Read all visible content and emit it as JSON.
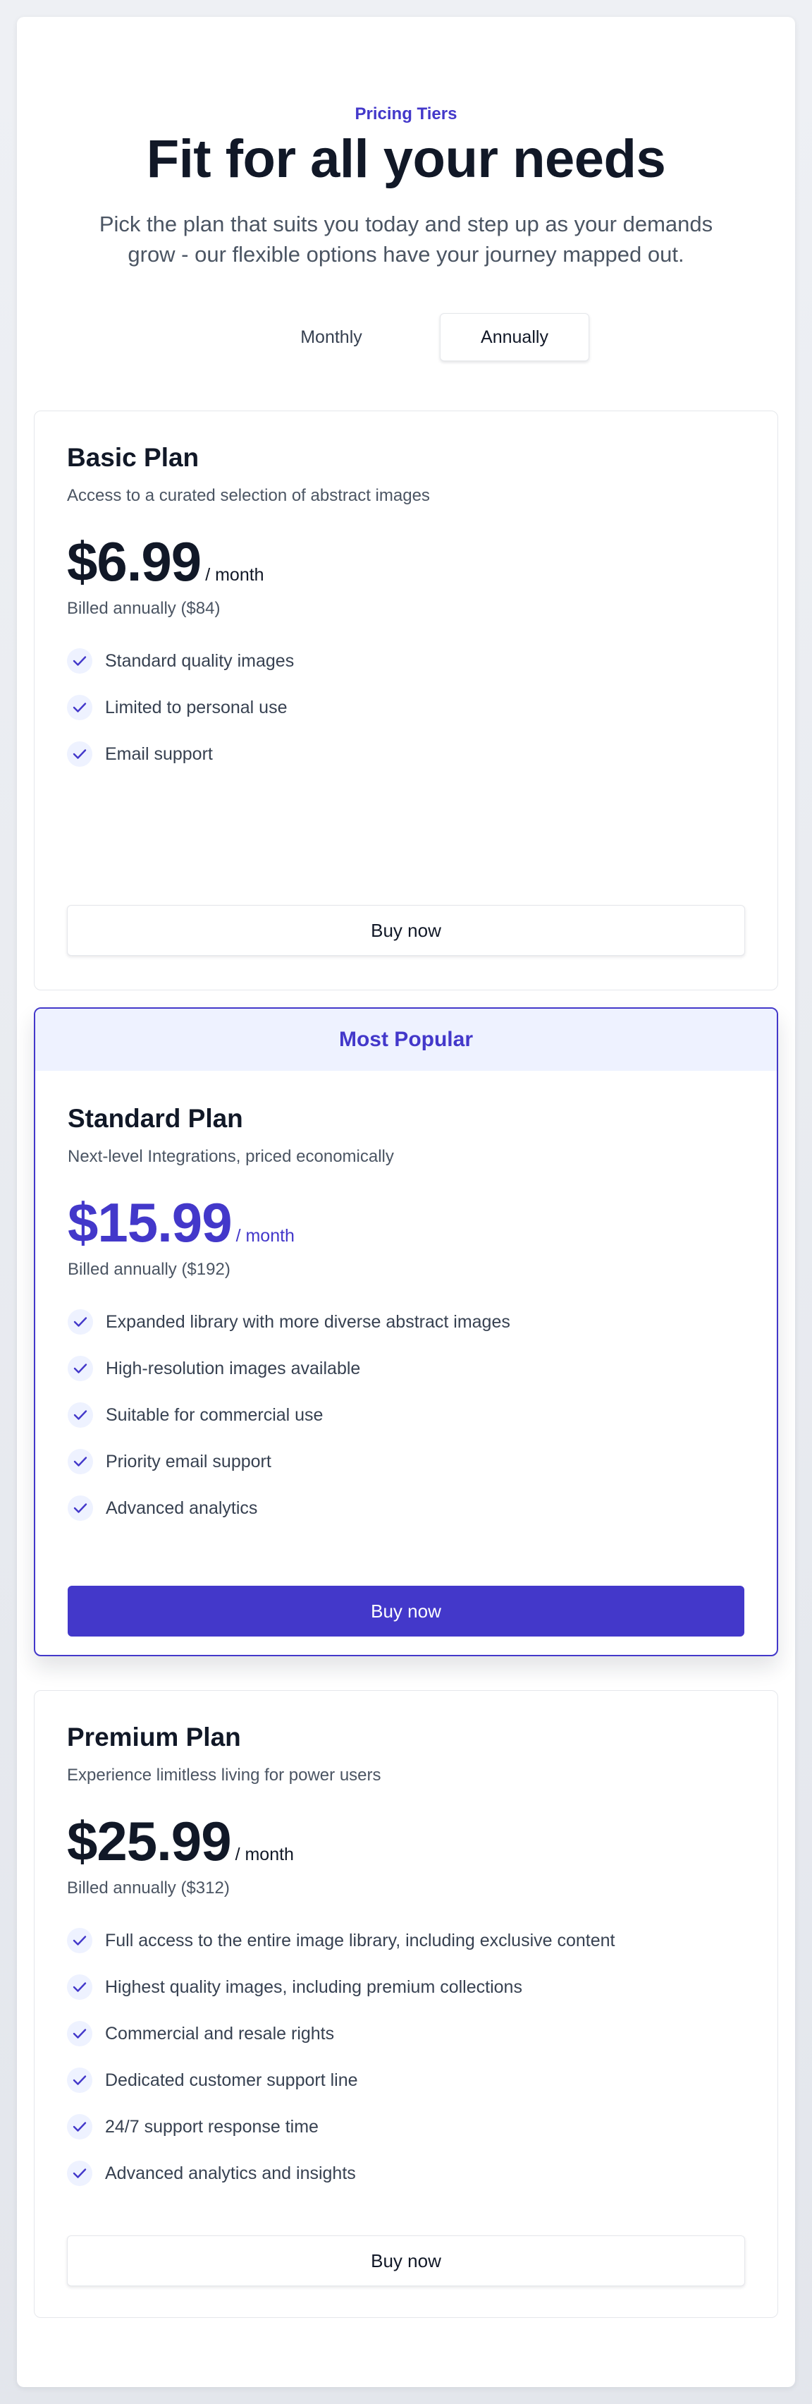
{
  "header": {
    "eyebrow": "Pricing Tiers",
    "title": "Fit for all your needs",
    "subtitle": "Pick the plan that suits you today and step up as your demands grow - our flexible options have your journey mapped out."
  },
  "billing_toggle": {
    "monthly_label": "Monthly",
    "annually_label": "Annually",
    "selected": "Annually"
  },
  "colors": {
    "accent": "#4338ca",
    "accent_light": "#eef2ff",
    "text": "#111827",
    "muted": "#4b5563"
  },
  "plans": [
    {
      "name": "Basic Plan",
      "description": "Access to a curated selection of abstract images",
      "price": "$6.99",
      "period": "/ month",
      "billed": "Billed annually ($84)",
      "features": [
        "Standard quality images",
        "Limited to personal use",
        "Email support"
      ],
      "cta": "Buy now"
    },
    {
      "badge": "Most Popular",
      "name": "Standard Plan",
      "description": "Next-level Integrations, priced economically",
      "price": "$15.99",
      "period": "/ month",
      "billed": "Billed annually ($192)",
      "features": [
        "Expanded library with more diverse abstract images",
        "High-resolution images available",
        "Suitable for commercial use",
        "Priority email support",
        "Advanced analytics"
      ],
      "cta": "Buy now"
    },
    {
      "name": "Premium Plan",
      "description": "Experience limitless living for power users",
      "price": "$25.99",
      "period": "/ month",
      "billed": "Billed annually ($312)",
      "features": [
        "Full access to the entire image library, including exclusive content",
        "Highest quality images, including premium collections",
        "Commercial and resale rights",
        "Dedicated customer support line",
        "24/7 support response time",
        "Advanced analytics and insights"
      ],
      "cta": "Buy now"
    }
  ]
}
